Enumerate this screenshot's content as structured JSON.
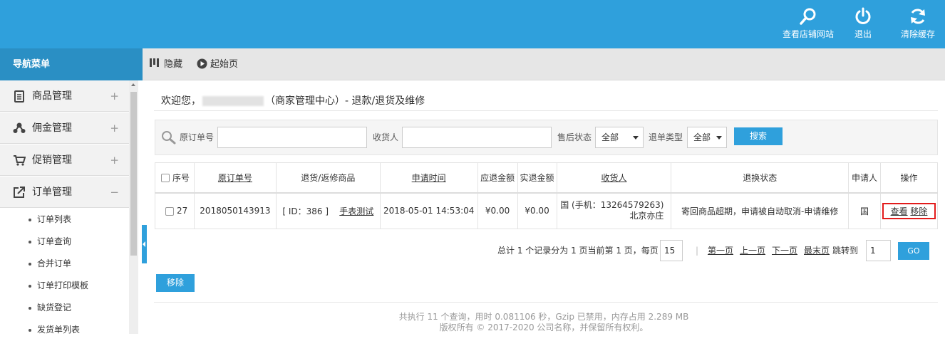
{
  "topbar": {
    "view_store": "查看店铺网站",
    "logout": "退出",
    "clear_cache": "清除缓存"
  },
  "sidebar": {
    "title": "导航菜单",
    "groups": [
      {
        "label": "商品管理",
        "sign": "+",
        "icon": "document-icon"
      },
      {
        "label": "佣金管理",
        "sign": "+",
        "icon": "network-icon"
      },
      {
        "label": "促销管理",
        "sign": "+",
        "icon": "cart-icon"
      },
      {
        "label": "订单管理",
        "sign": "−",
        "icon": "external-link-icon"
      }
    ],
    "sub_items": [
      "订单列表",
      "订单查询",
      "合并订单",
      "订单打印模板",
      "缺货登记",
      "发货单列表"
    ]
  },
  "subtoolbar": {
    "hide": "隐藏",
    "start_page": "起始页"
  },
  "welcome": {
    "prefix": "欢迎您，",
    "suffix": "（商家管理中心）- 退款/退货及维修"
  },
  "search": {
    "order_no_label": "原订单号",
    "order_no_value": "",
    "consignee_label": "收货人",
    "consignee_value": "",
    "aftersale_label": "售后状态",
    "aftersale_value": "全部",
    "return_type_label": "退单类型",
    "return_type_value": "全部",
    "button": "搜索"
  },
  "table": {
    "headers": [
      "序号",
      "原订单号",
      "退货/返修商品",
      "申请时间",
      "应退金额",
      "实退金额",
      "收货人",
      "退换状态",
      "申请人",
      "操作"
    ],
    "rows": [
      {
        "seq": "27",
        "order_no": "2018050143913",
        "goods_id": "[ ID：386 ]",
        "goods_name": "手表测试",
        "apply_time": "2018-05-01 14:53:04",
        "should_refund": "¥0.00",
        "actual_refund": "¥0.00",
        "consignee_line1": "国 (手机：13264579263)",
        "consignee_line2": "北京亦庄",
        "status": "寄回商品超期，申请被自动取消-申请维修",
        "applicant": "国",
        "view": "查看",
        "remove": "移除"
      }
    ]
  },
  "pager": {
    "summary": "总计 1 个记录分为 1 页当前第 1 页，每页",
    "per_page": "15",
    "first": "第一页",
    "prev": "上一页",
    "next": "下一页",
    "last": "最末页",
    "jump_label": "跳转到",
    "jump_value": "1",
    "go": "GO"
  },
  "bulk": {
    "remove": "移除"
  },
  "footer": {
    "line1": "共执行 11 个查询，用时 0.081106 秒，Gzip 已禁用，内存占用 2.289 MB",
    "line2": "版权所有 © 2017-2020 公司名称，并保留所有权利。"
  },
  "colors": {
    "brand": "#2fa0dc",
    "nav_title": "#2a8fc4",
    "highlight": "#e21b1b"
  }
}
